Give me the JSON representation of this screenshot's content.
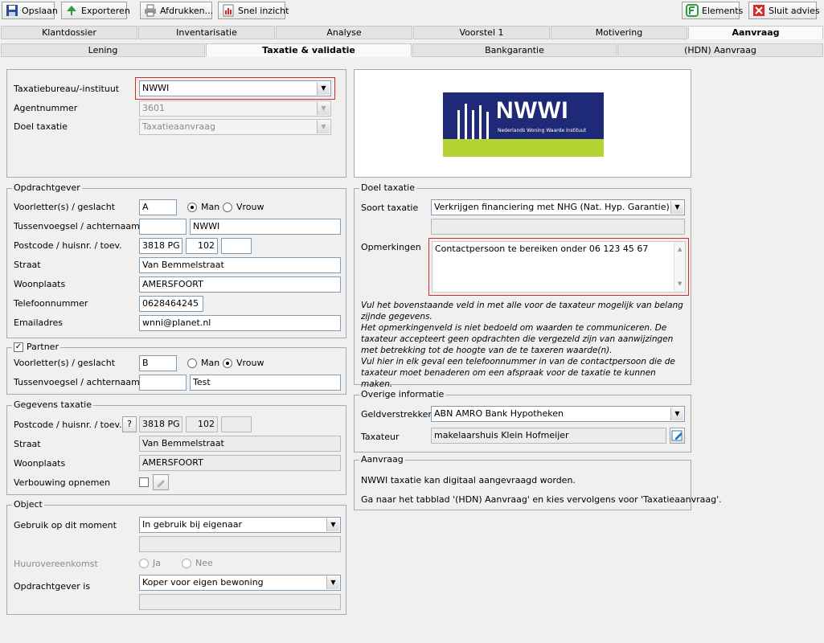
{
  "toolbar": {
    "save": "Opslaan",
    "export": "Exporteren",
    "print": "Afdrukken...",
    "quick": "Snel inzicht",
    "elements": "Elements",
    "close": "Sluit advies"
  },
  "main_tabs": [
    "Klantdossier",
    "Inventarisatie",
    "Analyse",
    "Voorstel 1",
    "Motivering",
    "Aanvraag"
  ],
  "sub_tabs": [
    "Lening",
    "Taxatie & validatie",
    "Bankgarantie",
    "(HDN) Aanvraag"
  ],
  "taxatie_top": {
    "bureau_label": "Taxatiebureau/-instituut",
    "bureau_value": "NWWI",
    "agent_label": "Agentnummer",
    "agent_value": "3601",
    "doel_label": "Doel taxatie",
    "doel_value": "Taxatieaanvraag"
  },
  "logo": {
    "text": "NWWI",
    "subtitle": "Nederlands Woning Waarde Instituut"
  },
  "opdrachtgever": {
    "legend": "Opdrachtgever",
    "initials_label": "Voorletter(s) / geslacht",
    "initials": "A",
    "man": "Man",
    "vrouw": "Vrouw",
    "tussen_label": "Tussenvoegsel / achternaam",
    "achternaam": "NWWI",
    "postcode_label": "Postcode / huisnr. / toev.",
    "postcode": "3818 PG",
    "huisnr": "102",
    "straat_label": "Straat",
    "straat": "Van Bemmelstraat",
    "woonplaats_label": "Woonplaats",
    "woonplaats": "AMERSFOORT",
    "telefoon_label": "Telefoonnummer",
    "telefoon": "0628464245",
    "email_label": "Emailadres",
    "email": "wnni@planet.nl"
  },
  "partner": {
    "legend": "Partner",
    "initials_label": "Voorletter(s) / geslacht",
    "initials": "B",
    "man": "Man",
    "vrouw": "Vrouw",
    "tussen_label": "Tussenvoegsel / achternaam",
    "achternaam": "Test"
  },
  "gegevens": {
    "legend": "Gegevens taxatie",
    "postcode_label": "Postcode / huisnr. / toev.",
    "help": "?",
    "postcode": "3818 PG",
    "huisnr": "102",
    "straat_label": "Straat",
    "straat": "Van Bemmelstraat",
    "woonplaats_label": "Woonplaats",
    "woonplaats": "AMERSFOORT",
    "verbouwing_label": "Verbouwing opnemen"
  },
  "object": {
    "legend": "Object",
    "gebruik_label": "Gebruik op dit moment",
    "gebruik_value": "In gebruik bij eigenaar",
    "huur_label": "Huurovereenkomst",
    "ja": "Ja",
    "nee": "Nee",
    "opdrachtgever_label": "Opdrachtgever is",
    "opdrachtgever_value": "Koper voor eigen bewoning"
  },
  "doel": {
    "legend": "Doel taxatie",
    "soort_label": "Soort taxatie",
    "soort_value": "Verkrijgen financiering met NHG (Nat. Hyp. Garantie)",
    "opm_label": "Opmerkingen",
    "opm_value": "Contactpersoon te bereiken onder 06 123 45 67",
    "note1": "Vul het bovenstaande veld in met alle voor de taxateur mogelijk van belang zijnde gegevens.",
    "note2": "Het opmerkingenveld is niet bedoeld om waarden te communiceren. De taxateur accepteert geen opdrachten die vergezeld zijn van aanwijzingen met betrekking tot de hoogte van de te taxeren waarde(n).",
    "note3": "Vul hier in elk geval een telefoonnummer in van de contactpersoon die de taxateur moet benaderen om een afspraak voor de taxatie te kunnen maken."
  },
  "overige": {
    "legend": "Overige informatie",
    "geld_label": "Geldverstrekker",
    "geld_value": "ABN AMRO Bank Hypotheken",
    "taxateur_label": "Taxateur",
    "taxateur_value": "makelaarshuis Klein Hofmeijer"
  },
  "aanvraag": {
    "legend": "Aanvraag",
    "line1": "NWWI taxatie kan digitaal aangevraagd worden.",
    "line2": "Ga naar het tabblad '(HDN) Aanvraag' en kies vervolgens voor 'Taxatieaanvraag'."
  },
  "colors": {
    "accent_red": "#d42a2a",
    "logo_blue": "#1e2a78",
    "logo_green": "#b6d334"
  }
}
